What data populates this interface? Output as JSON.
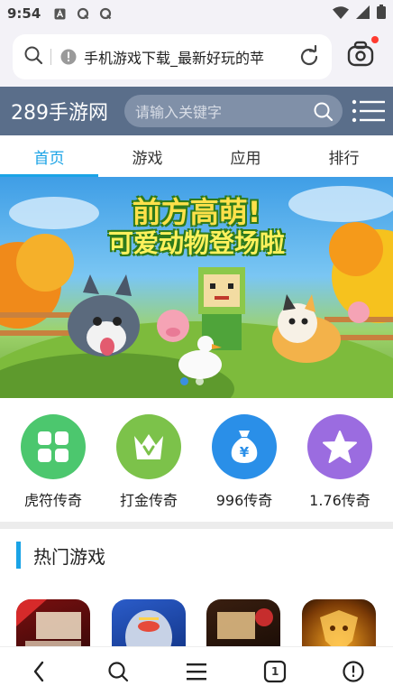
{
  "status_bar": {
    "time": "9:54",
    "icons": [
      "a-icon",
      "q-icon",
      "q-icon",
      "wifi-icon",
      "signal-icon",
      "battery-icon"
    ]
  },
  "browser": {
    "url_text": "手机游戏下载_最新好玩的苹",
    "tab_count": "1"
  },
  "site": {
    "logo": "289手游网",
    "search_placeholder": "请输入关键字"
  },
  "tabs": [
    {
      "label": "首页",
      "active": true
    },
    {
      "label": "游戏",
      "active": false
    },
    {
      "label": "应用",
      "active": false
    },
    {
      "label": "排行",
      "active": false
    }
  ],
  "banner": {
    "line1": "前方高萌!",
    "line2": "可爱动物登场啦",
    "slide_count": 2,
    "active_slide": 1
  },
  "quick_links": [
    {
      "label": "虎符传奇",
      "color": "#4cc76e",
      "icon": "grid-icon"
    },
    {
      "label": "打金传奇",
      "color": "#7cc24a",
      "icon": "crown-icon"
    },
    {
      "label": "996传奇",
      "color": "#2a8fe8",
      "icon": "money-bag-icon"
    },
    {
      "label": "1.76传奇",
      "color": "#9b6ce0",
      "icon": "star-icon"
    }
  ],
  "hot_games": {
    "title": "热门游戏"
  },
  "colors": {
    "accent": "#1aa3e6",
    "header": "#5a6e8a"
  }
}
